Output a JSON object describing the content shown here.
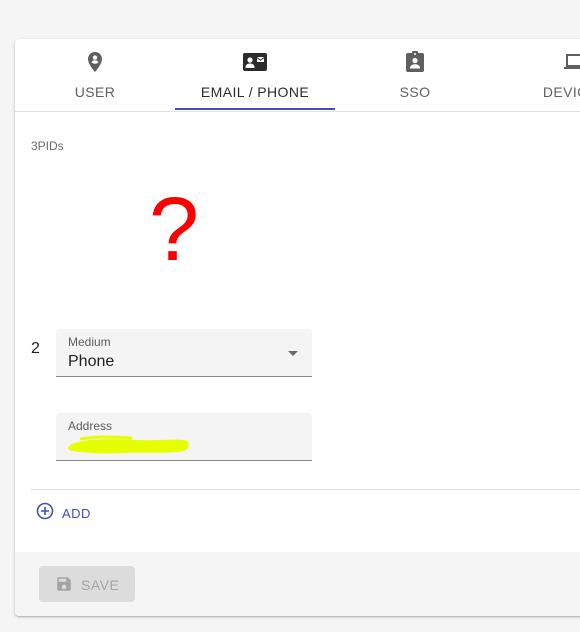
{
  "tabs": [
    {
      "label": "USER",
      "icon": "account-circle-icon"
    },
    {
      "label": "EMAIL / PHONE",
      "icon": "contact-mail-icon",
      "active": true
    },
    {
      "label": "SSO",
      "icon": "assignment-ind-icon"
    },
    {
      "label": "DEVICES",
      "icon": "laptop-icon"
    }
  ],
  "section": {
    "label": "3PIDs",
    "annotation": "?"
  },
  "entries": [
    {
      "index": "2",
      "medium_label": "Medium",
      "medium_value": "Phone",
      "address_label": "Address"
    }
  ],
  "actions": {
    "add_label": "ADD",
    "save_label": "SAVE"
  },
  "colors": {
    "accent": "#3f51b5",
    "annotation": "#ff0000",
    "redaction": "#e5ff00"
  }
}
